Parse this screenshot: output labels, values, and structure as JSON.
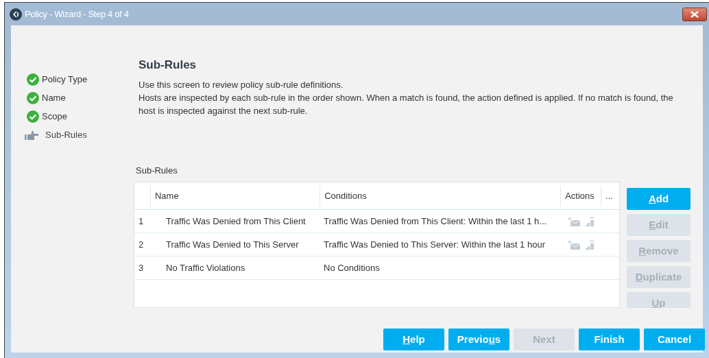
{
  "window": {
    "title": "Policy - Wizard - Step 4 of 4"
  },
  "steps": [
    {
      "label": "Policy Type",
      "kind": "done"
    },
    {
      "label": "Name",
      "kind": "done"
    },
    {
      "label": "Scope",
      "kind": "done"
    },
    {
      "label": "Sub-Rules",
      "kind": "current"
    }
  ],
  "heading": "Sub-Rules",
  "description": [
    "Use this screen to review policy sub-rule definitions.",
    "Hosts are inspected by each sub-rule in the order shown. When a match is found, the action defined is applied. If no match is found, the host is inspected against the next sub-rule."
  ],
  "table": {
    "label": "Sub-Rules",
    "columns": [
      "Name",
      "Conditions",
      "Actions",
      "..."
    ],
    "rows": [
      {
        "index": "1",
        "name": "Traffic Was Denied from This Client",
        "conditions": "Traffic Was Denied from This Client: Within the last 1 h...",
        "actions": [
          {
            "kind": "mail"
          },
          {
            "kind": "log"
          }
        ]
      },
      {
        "index": "2",
        "name": "Traffic Was Denied to This Server",
        "conditions": "Traffic Was Denied to This Server: Within the last 1 hour",
        "actions": [
          {
            "kind": "mail"
          },
          {
            "kind": "log"
          }
        ]
      },
      {
        "index": "3",
        "name": "No Traffic Violations",
        "conditions": "No Conditions"
      }
    ]
  },
  "side_buttons": [
    {
      "key": "A",
      "post": "dd",
      "disabled": false
    },
    {
      "key": "E",
      "post": "dit",
      "disabled": true
    },
    {
      "key": "R",
      "post": "emove",
      "disabled": true
    },
    {
      "key": "D",
      "post": "uplicate",
      "disabled": true
    },
    {
      "key": "U",
      "post": "p",
      "disabled": true
    }
  ],
  "footer_buttons": [
    {
      "key": "H",
      "post": "elp",
      "disabled": false
    },
    {
      "pre": "Previo",
      "key": "u",
      "post": "s",
      "disabled": false
    },
    {
      "pre": "Next",
      "disabled": true
    },
    {
      "pre": "Finish",
      "disabled": false
    },
    {
      "pre": "Cancel",
      "disabled": false
    }
  ]
}
